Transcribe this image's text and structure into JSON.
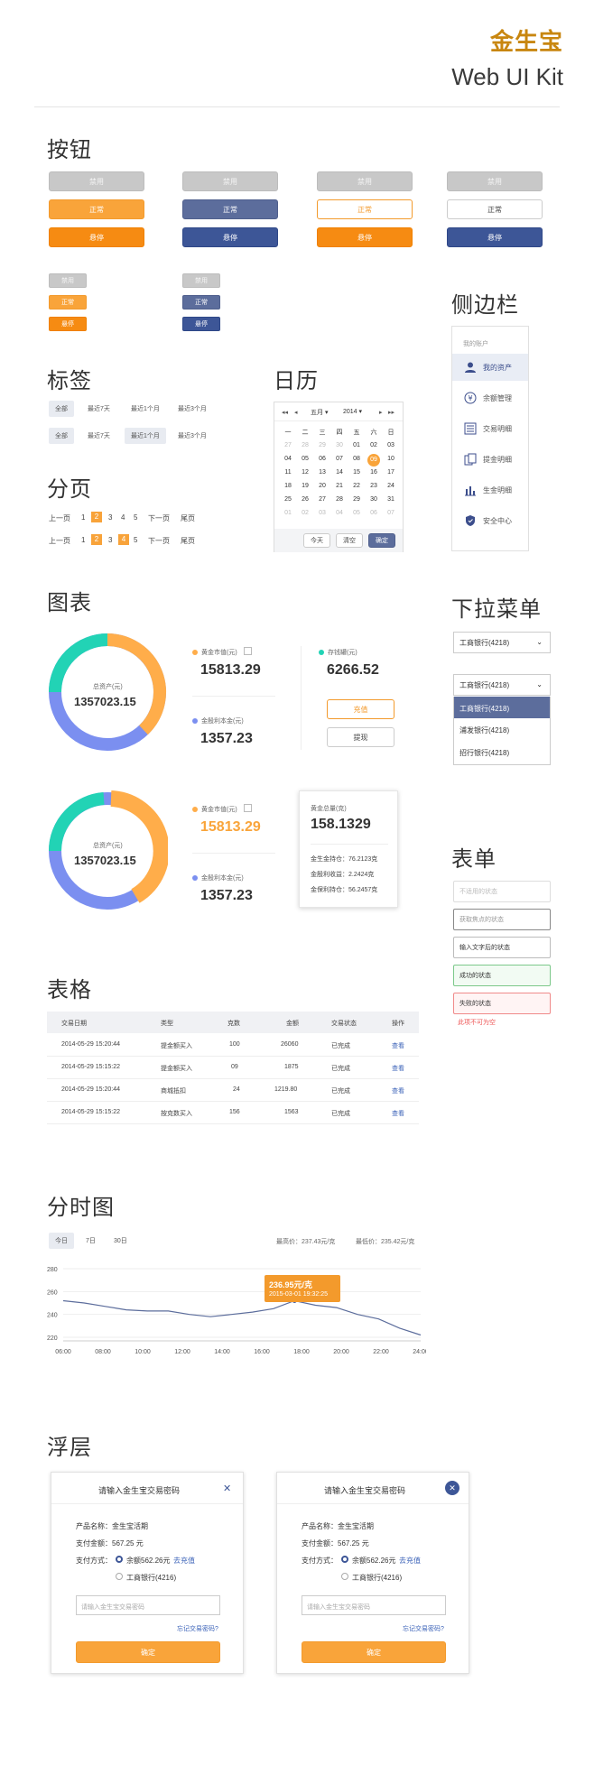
{
  "brand": {
    "logo": "金生宝",
    "subtitle": "Web UI Kit"
  },
  "sections": {
    "buttons": "按钮",
    "tags": "标签",
    "calendar": "日历",
    "pagination": "分页",
    "sidebar": "侧边栏",
    "chart": "图表",
    "dropdown": "下拉菜单",
    "form": "表单",
    "table": "表格",
    "timechart": "分时图",
    "overlay": "浮层"
  },
  "buttons": {
    "disabled": "禁用",
    "normal": "正常",
    "hover": "悬停"
  },
  "tags": {
    "row1": [
      "全部",
      "最近7天",
      "最近1个月",
      "最近3个月"
    ],
    "row2": [
      "全部",
      "最近7天",
      "最近1个月",
      "最近3个月"
    ]
  },
  "pagination": {
    "prev": "上一页",
    "next": "下一页",
    "last": "尾页",
    "pages": [
      "1",
      "2",
      "3",
      "4",
      "5"
    ]
  },
  "calendar": {
    "month": "五月",
    "year": "2014",
    "weekdays": [
      "一",
      "二",
      "三",
      "四",
      "五",
      "六",
      "日"
    ],
    "days": [
      [
        "27",
        "28",
        "29",
        "30",
        "01",
        "02",
        "03"
      ],
      [
        "04",
        "05",
        "06",
        "07",
        "08",
        "09",
        "10"
      ],
      [
        "11",
        "12",
        "13",
        "14",
        "15",
        "16",
        "17"
      ],
      [
        "18",
        "19",
        "20",
        "21",
        "22",
        "23",
        "24"
      ],
      [
        "25",
        "26",
        "27",
        "28",
        "29",
        "30",
        "31"
      ],
      [
        "01",
        "02",
        "03",
        "04",
        "05",
        "06",
        "07"
      ]
    ],
    "today_btn": "今天",
    "clear_btn": "清空",
    "ok_btn": "确定"
  },
  "sidebar": {
    "header": "我的账户",
    "items": [
      {
        "label": "我的资产",
        "icon": "user-icon"
      },
      {
        "label": "余额管理",
        "icon": "yen-icon"
      },
      {
        "label": "交易明细",
        "icon": "list-icon"
      },
      {
        "label": "提金明细",
        "icon": "gold-icon"
      },
      {
        "label": "生金明细",
        "icon": "bar-chart-icon"
      },
      {
        "label": "安全中心",
        "icon": "shield-icon"
      }
    ]
  },
  "donut1": {
    "center_label": "总资产(元)",
    "center_value": "1357023.15",
    "gold_label": "黄金市值(元)",
    "gold_value": "15813.29",
    "bal_label": "存钱罐(元)",
    "bal_value": "6266.52",
    "interest_label": "金殷利本金(元)",
    "interest_value": "1357.23",
    "recharge": "充值",
    "withdraw": "提现"
  },
  "donut2": {
    "center_label": "总资产(元)",
    "center_value": "1357023.15",
    "gold_label": "黄金市值(元)",
    "gold_value": "15813.29",
    "interest_label": "金殷利本金(元)",
    "interest_value": "1357.23",
    "tip_label": "黄金总量(克)",
    "tip_value": "158.1329",
    "tip_lines": [
      "金生金持仓：76.2123克",
      "金殷利收益：2.2424克",
      "金保利持仓：56.2457克"
    ]
  },
  "dropdown": {
    "selected": "工商银行(4218)",
    "options": [
      "工商银行(4218)",
      "浦发银行(4218)",
      "招行银行(4218)"
    ]
  },
  "form": {
    "disabled": "不适用的状态",
    "focus": "获取焦点的状态",
    "filled": "输入文字后的状态",
    "success": "成功的状态",
    "error": "失败的状态",
    "error_msg": "此项不可为空"
  },
  "table": {
    "headers": [
      "交易日期",
      "类型",
      "克数",
      "金额",
      "交易状态",
      "操作"
    ],
    "rows": [
      [
        "2014-05-29 15:20:44",
        "提金额买入",
        "100",
        "26060",
        "已完成",
        "查看"
      ],
      [
        "2014-05-29 15:15:22",
        "提金额买入",
        "09",
        "1875",
        "已完成",
        "查看"
      ],
      [
        "2014-05-29 15:20:44",
        "商城抵扣",
        "24",
        "1219.80",
        "已完成",
        "查看"
      ],
      [
        "2014-05-29 15:15:22",
        "按克数买入",
        "156",
        "1563",
        "已完成",
        "查看"
      ]
    ]
  },
  "timechart": {
    "tabs": [
      "今日",
      "7日",
      "30日"
    ],
    "high": "最高价：237.43元/克",
    "low": "最低价：235.42元/克",
    "tip_price": "236.95元/克",
    "tip_time": "2015-03-01  19:32:25"
  },
  "chart_data": {
    "type": "line",
    "x": [
      "06:00",
      "08:00",
      "10:00",
      "12:00",
      "14:00",
      "16:00",
      "18:00",
      "20:00",
      "22:00",
      "24:00"
    ],
    "y_ticks": [
      "280",
      "260",
      "240",
      "220"
    ],
    "ylim": [
      220,
      280
    ],
    "values": [
      252,
      250,
      247,
      244,
      243,
      243,
      240,
      238,
      240,
      242,
      245,
      252,
      248,
      246,
      240,
      236,
      228,
      222
    ],
    "grid": true
  },
  "modal": {
    "title": "请输入金生宝交易密码",
    "product": "产品名称：金生宝活期",
    "amount": "支付金额：567.25 元",
    "method": "支付方式：",
    "opt1": "余额562.26元",
    "recharge": "去充值",
    "opt2": "工商银行(4216)",
    "placeholder": "请输入金生宝交易密码",
    "forgot": "忘记交易密码?",
    "ok": "确定"
  },
  "colors": {
    "orange": "#f9a43a",
    "blue": "#3d5697",
    "teal": "#22d3b5",
    "purple": "#7b8ff0"
  }
}
